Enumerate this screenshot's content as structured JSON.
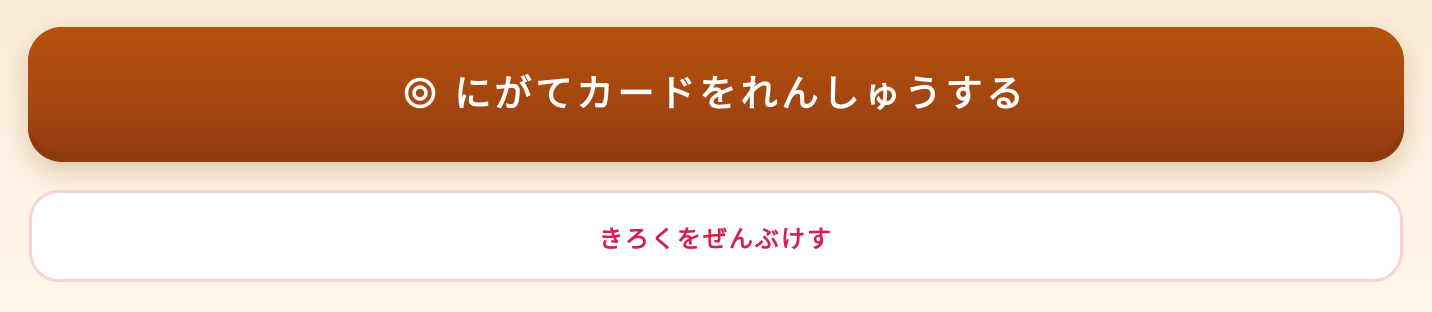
{
  "practice_button": {
    "icon": "target-icon",
    "label": "にがてカードをれんしゅうする"
  },
  "clear_button": {
    "label": "きろくをぜんぶけす"
  },
  "colors": {
    "primary_button": "#a9490f",
    "primary_button_shadow": "#8c3b11",
    "secondary_text": "#d4204f",
    "secondary_border": "#fbcfd8",
    "background": "#fdf3e4"
  }
}
